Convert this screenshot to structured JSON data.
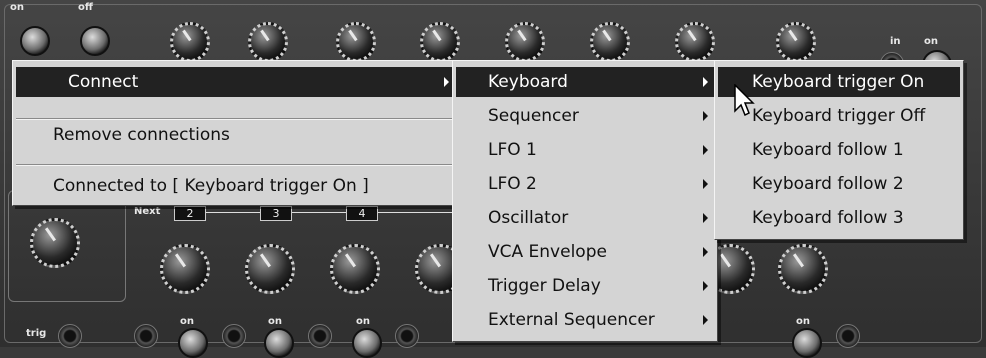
{
  "synth": {
    "labels": {
      "on_1": "on",
      "off": "off",
      "in": "in",
      "on_2": "on",
      "next": "Next",
      "trig": "trig",
      "on_3": "on",
      "on_4": "on",
      "on_5": "on",
      "on_6": "on"
    },
    "step_numbers": [
      "2",
      "3",
      "4"
    ]
  },
  "context_menu": {
    "connect": "Connect",
    "remove_connections": "Remove connections",
    "connected_to": "Connected to [ Keyboard trigger On ]"
  },
  "source_menu": {
    "items": [
      "Keyboard",
      "Sequencer",
      "LFO 1",
      "LFO 2",
      "Oscillator",
      "VCA Envelope",
      "Trigger Delay",
      "External Sequencer"
    ]
  },
  "keyboard_menu": {
    "items": [
      "Keyboard trigger On",
      "Keyboard trigger Off",
      "Keyboard follow 1",
      "Keyboard follow 2",
      "Keyboard follow 3"
    ]
  },
  "colors": {
    "menu_bg": "#d4d4d4",
    "highlight": "#222222",
    "synth_bg": "#3a3a3a"
  },
  "icons": [
    "submenu-arrow-icon",
    "mouse-pointer-icon"
  ]
}
